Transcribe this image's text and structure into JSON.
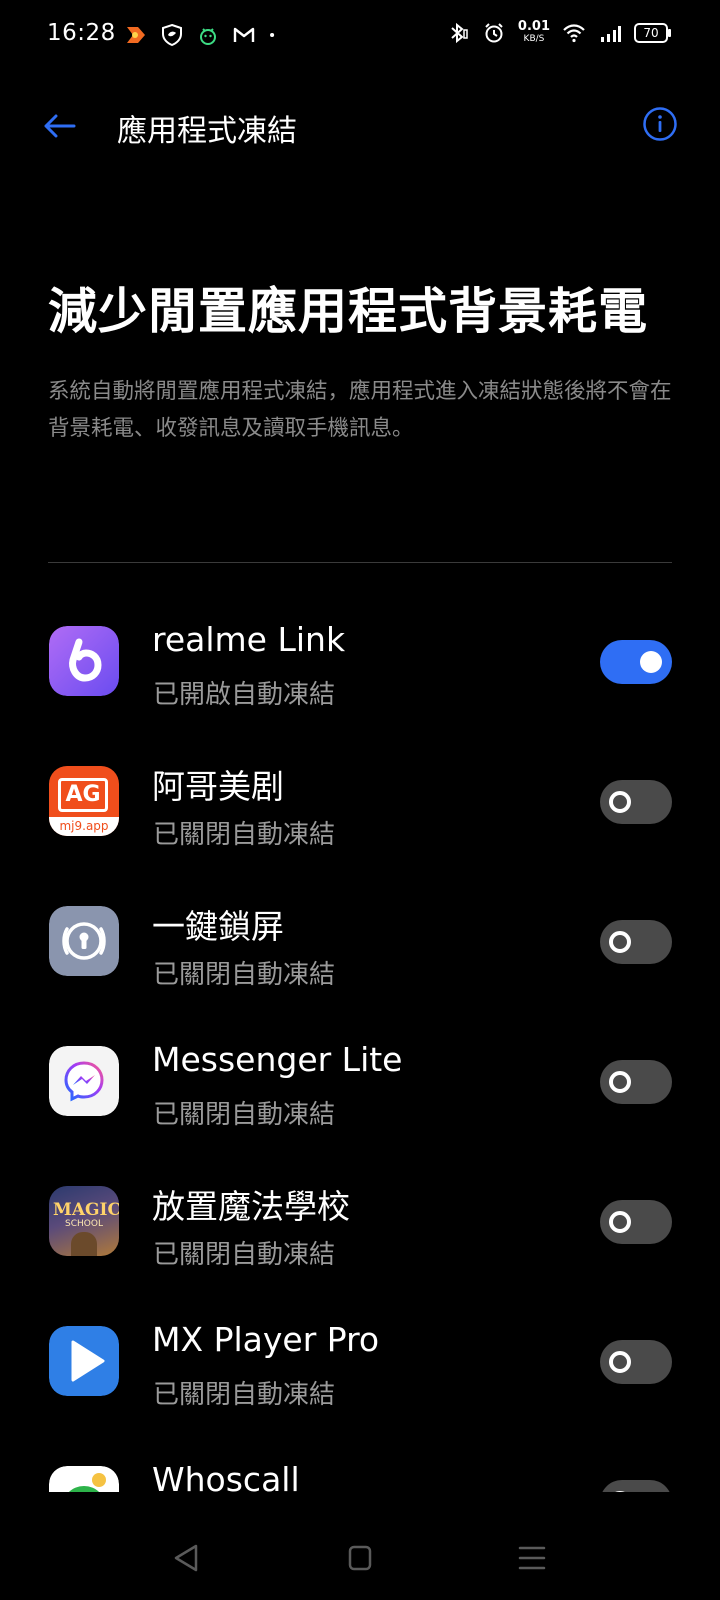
{
  "status_bar": {
    "time": "16:28",
    "net_speed_value": "0.01",
    "net_speed_unit": "KB/S",
    "battery_level": "70",
    "left_icons": [
      "app-notification-icon",
      "shield-icon",
      "android-icon",
      "gmail-icon",
      "dot-icon"
    ],
    "right_icons": [
      "bluetooth-icon",
      "alarm-icon",
      "wifi-icon",
      "signal-icon",
      "battery-icon"
    ]
  },
  "header": {
    "title": "應用程式凍結",
    "back_icon": "back-arrow-icon",
    "info_icon": "info-icon"
  },
  "hero": {
    "title": "減少閒置應用程式背景耗電",
    "description": "系統自動將閒置應用程式凍結，應用程式進入凍結狀態後將不會在背景耗電、收發訊息及讀取手機訊息。"
  },
  "apps": [
    {
      "name": "realme Link",
      "status": "已開啟自動凍結",
      "enabled": true,
      "icon": "realme-link-icon"
    },
    {
      "name": "阿哥美剧",
      "status": "已關閉自動凍結",
      "enabled": false,
      "icon": "agmj-icon",
      "icon_text": "AG",
      "icon_subtext": "mj9.app"
    },
    {
      "name": "一鍵鎖屏",
      "status": "已關閉自動凍結",
      "enabled": false,
      "icon": "lock-screen-icon"
    },
    {
      "name": "Messenger Lite",
      "status": "已關閉自動凍結",
      "enabled": false,
      "icon": "messenger-lite-icon"
    },
    {
      "name": "放置魔法學校",
      "status": "已關閉自動凍結",
      "enabled": false,
      "icon": "magic-school-icon",
      "icon_text": "MAGIC",
      "icon_subtext": "SCHOOL"
    },
    {
      "name": "MX Player Pro",
      "status": "已關閉自動凍結",
      "enabled": false,
      "icon": "mx-player-icon"
    },
    {
      "name": "Whoscall",
      "status": "",
      "enabled": false,
      "icon": "whoscall-icon"
    }
  ],
  "colors": {
    "accent": "#2f6ef4",
    "background": "#000000",
    "secondary_text": "#9a9a9a"
  },
  "nav_bar": {
    "icons": [
      "nav-back-icon",
      "nav-home-icon",
      "nav-recents-icon"
    ]
  }
}
